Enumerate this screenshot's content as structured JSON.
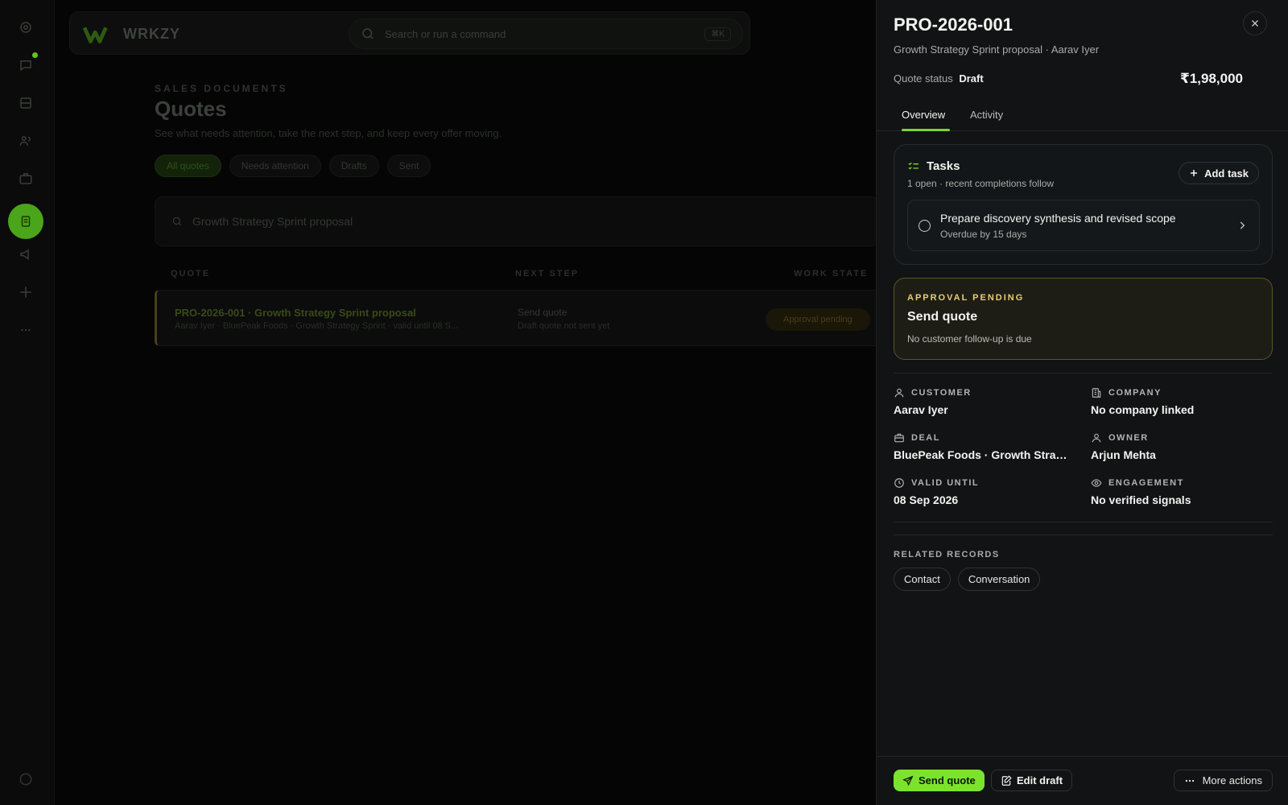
{
  "background": {
    "logo_text": "WRKZY",
    "search_placeholder": "Search or run a command",
    "search_kbd": "⌘K",
    "eyebrow": "SALES DOCUMENTS",
    "title": "Quotes",
    "subtitle": "See what needs attention, take the next step, and keep every offer moving.",
    "chips": [
      "All quotes",
      "Needs attention",
      "Drafts",
      "Sent"
    ],
    "filter_value": "Growth Strategy Sprint proposal",
    "columns": [
      "QUOTE",
      "NEXT STEP",
      "WORK STATE"
    ],
    "row": {
      "title": "PRO-2026-001 · Growth Strategy Sprint proposal",
      "meta": "Aarav Iyer · BluePeak Foods · Growth Strategy Sprint · valid until 08 S...",
      "step": "Send quote",
      "step_sub": "Draft quote not sent yet",
      "badge": "Approval pending"
    }
  },
  "drawer": {
    "id": "PRO-2026-001",
    "subtitle": "Growth Strategy Sprint proposal · Aarav Iyer",
    "status_label": "Quote status",
    "status_value": "Draft",
    "amount": "₹1,98,000",
    "tabs": [
      "Overview",
      "Activity"
    ],
    "tasks": {
      "title": "Tasks",
      "subtitle": "1 open · recent completions follow",
      "add_label": "Add task",
      "items": [
        {
          "title": "Prepare discovery synthesis and revised scope",
          "due": "Overdue by 15 days"
        }
      ]
    },
    "approval": {
      "eyebrow": "APPROVAL PENDING",
      "title": "Send quote",
      "subtitle": "No customer follow-up is due"
    },
    "meta": {
      "customer": {
        "label": "CUSTOMER",
        "value": "Aarav Iyer"
      },
      "company": {
        "label": "COMPANY",
        "value": "No company linked"
      },
      "deal": {
        "label": "DEAL",
        "value": "BluePeak Foods · Growth Strategy Sprint"
      },
      "owner": {
        "label": "OWNER",
        "value": "Arjun Mehta"
      },
      "valid_until": {
        "label": "VALID UNTIL",
        "value": "08 Sep 2026"
      },
      "engagement": {
        "label": "ENGAGEMENT",
        "value": "No verified signals"
      }
    },
    "related": {
      "label": "RELATED RECORDS",
      "items": [
        "Contact",
        "Conversation"
      ]
    },
    "footer": {
      "primary": "Send quote",
      "secondary": "Edit draft",
      "more": "More actions"
    }
  },
  "colors": {
    "accent": "#7ce32d",
    "approval_border": "#5b5429",
    "approval_text": "#e6cf74"
  }
}
